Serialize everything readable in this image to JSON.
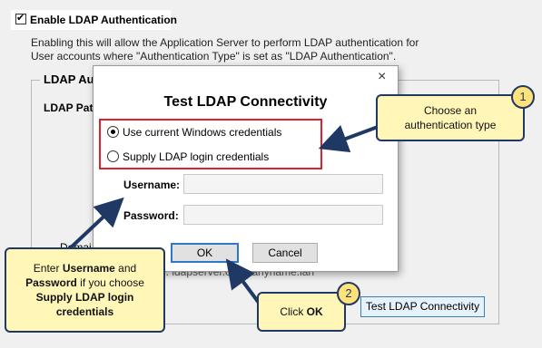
{
  "settings": {
    "enable_label": "Enable LDAP Authentication",
    "description_line1": "Enabling this will allow the Application Server to perform LDAP authentication for",
    "description_line2": "User accounts where \"Authentication Type\" is set as \"LDAP Authentication\".",
    "group_title": "LDAP Au",
    "ldap_path_label": "LDAP Pat",
    "domain_label": "Domai",
    "hint_text": "e: ldapserver.companyname.lan",
    "test_button": "Test LDAP Connectivity"
  },
  "dialog": {
    "close": "×",
    "title": "Test LDAP Connectivity",
    "radio_current": "Use current Windows credentials",
    "radio_supply": "Supply LDAP login credentials",
    "username_label": "Username:",
    "password_label": "Password:",
    "ok": "OK",
    "cancel": "Cancel"
  },
  "callouts": {
    "one": {
      "badge": "1",
      "line1": "Choose an",
      "line2": "authentication type"
    },
    "two": {
      "badge": "2",
      "prefix": "Click ",
      "bold": "OK"
    },
    "three": {
      "l1_pre": "Enter ",
      "l1_bold": "Username",
      "l1_post": " and",
      "l2_bold": "Password",
      "l2_post": " if you choose",
      "l3_bold": "Supply LDAP login",
      "l4_bold": "credentials"
    }
  },
  "colors": {
    "highlight": "#e0202c",
    "callout_bg": "#fff6b8",
    "callout_border": "#1f3864",
    "arrow": "#1f3864"
  }
}
